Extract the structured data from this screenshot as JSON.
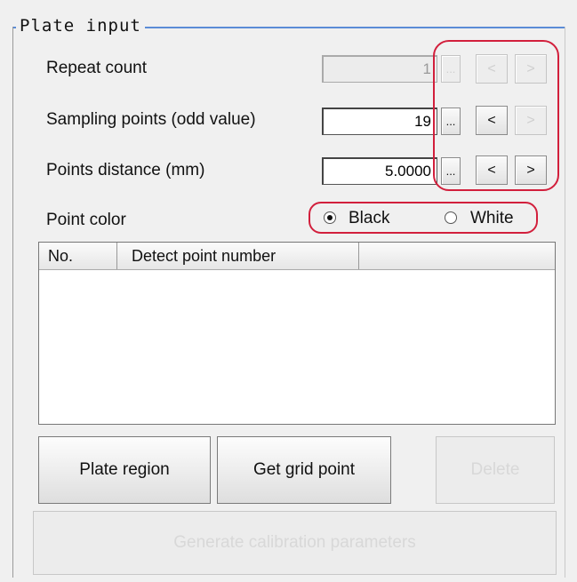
{
  "group": {
    "title": "Plate input"
  },
  "fields": {
    "repeat_count": {
      "label": "Repeat count",
      "value": "1",
      "ellipsis": "...",
      "prev": "<",
      "next": ">"
    },
    "sampling_points": {
      "label": "Sampling points (odd value)",
      "value": "19",
      "ellipsis": "...",
      "prev": "<",
      "next": ">"
    },
    "points_distance": {
      "label": "Points distance (mm)",
      "value": "5.0000",
      "ellipsis": "...",
      "prev": "<",
      "next": ">"
    }
  },
  "point_color": {
    "label": "Point color",
    "options": [
      "Black",
      "White"
    ],
    "selected": "Black"
  },
  "table": {
    "columns": [
      "No.",
      "Detect point number"
    ],
    "rows": []
  },
  "buttons": {
    "plate_region": "Plate region",
    "get_grid_point": "Get grid point",
    "delete": "Delete",
    "generate": "Generate calibration parameters"
  },
  "colors": {
    "highlight": "#d21f3c",
    "frame": "#5b8cd6"
  }
}
